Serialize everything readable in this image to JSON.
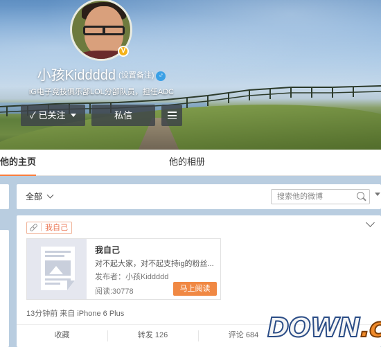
{
  "profile": {
    "name": "小孩Kiddddd",
    "remark_link": "(设置备注)",
    "gender_symbol": "♂",
    "verified_badge": "V",
    "bio": "iG电子竞技俱乐部LOL分部队员，担任ADC"
  },
  "actions": {
    "follow_label": "已关注",
    "follow_check": "✓",
    "message_label": "私信"
  },
  "tabs": [
    {
      "label": "他的主页",
      "active": true
    },
    {
      "label": "他的相册",
      "active": false
    }
  ],
  "filter": {
    "all_label": "全部",
    "search_placeholder": "搜索他的微博"
  },
  "post": {
    "tag_label": "我自己",
    "article": {
      "title": "我自己",
      "description": "对不起大家，对不起支持ig的粉丝...",
      "author": "发布者：小孩Kiddddd",
      "reads": "阅读:30778",
      "read_button": "马上阅读"
    },
    "meta": "13分钟前 来自 iPhone 6 Plus",
    "bar": {
      "favorite": "收藏",
      "forward": "转发 126",
      "comment": "评论 684"
    }
  },
  "watermark": {
    "main": "DOWN",
    "suffix": ".cc"
  },
  "colors": {
    "accent_orange": "#f08843",
    "tab_underline": "#fa7d3c",
    "page_bg": "#b9cde0"
  }
}
